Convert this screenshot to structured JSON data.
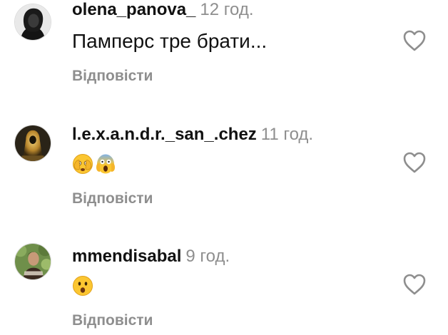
{
  "comments": [
    {
      "username": "olena_panova_",
      "time": "12 год.",
      "text": "Памперс тре брати...",
      "emojis": [],
      "reply_label": "Відповісти",
      "avatar_icon": "profile-photo-dark-haired-woman",
      "like_icon": "heart-outline-icon"
    },
    {
      "username": "l.e.x.a.n.d.r._san_.chez",
      "time": "11 год.",
      "text": "",
      "emojis": [
        "face-with-hand-over-eyes-emoji",
        "face-screaming-in-fear-emoji"
      ],
      "reply_label": "Відповісти",
      "avatar_icon": "profile-photo-golden-hooded-figure",
      "like_icon": "heart-outline-icon"
    },
    {
      "username": "mmendisabal",
      "time": "9 год.",
      "text": "",
      "emojis": [
        "face-with-open-mouth-emoji"
      ],
      "reply_label": "Відповісти",
      "avatar_icon": "profile-photo-woman-outdoors",
      "like_icon": "heart-outline-icon"
    }
  ],
  "colors": {
    "username": "#111111",
    "secondary_text": "#8e8e8e",
    "background": "#ffffff",
    "emoji_yellow": "#fbc631"
  }
}
